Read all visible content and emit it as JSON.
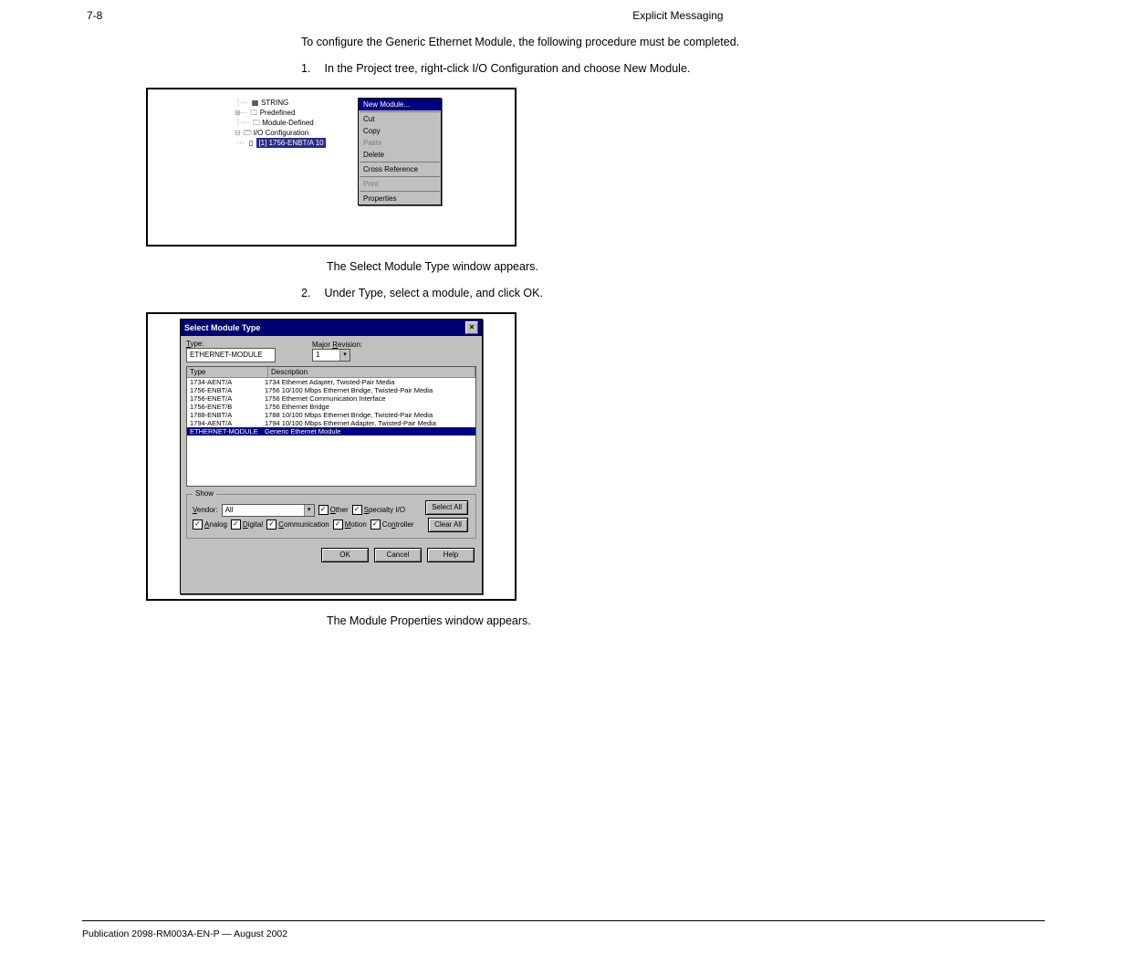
{
  "header": {
    "page_number": "7-8",
    "section": "Explicit Messaging"
  },
  "intro_text": "To configure the Generic Ethernet Module, the following procedure must be completed.",
  "step1": "In the Project tree, right-click I/O Configuration and choose New Module.",
  "tree": {
    "item_string": "STRING",
    "item_predefined": "Predefined",
    "item_module_defined": "Module-Defined",
    "item_io_config": "I/O Configuration",
    "selected_module": "[1] 1756-ENBT/A 10"
  },
  "context_menu": {
    "new_module": "New Module...",
    "cut": "Cut",
    "copy": "Copy",
    "paste": "Paste",
    "delete": "Delete",
    "cross_reference": "Cross Reference",
    "print": "Print",
    "properties": "Properties"
  },
  "step2": "The Select Module Type window appears.",
  "step3": "Under Type, select a module, and click OK.",
  "dialog": {
    "title": "Select Module Type",
    "type_label": "Type:",
    "type_value": "ETHERNET-MODULE",
    "major_rev_label": "Major Revision:",
    "major_rev_value": "1",
    "col_type": "Type",
    "col_desc": "Description",
    "rows": [
      {
        "type": "1734-AENT/A",
        "desc": "1734 Ethernet Adapter, Twisted-Pair Media"
      },
      {
        "type": "1756-ENBT/A",
        "desc": "1756 10/100 Mbps Ethernet Bridge, Twisted-Pair Media"
      },
      {
        "type": "1756-ENET/A",
        "desc": "1756 Ethernet Communication Interface"
      },
      {
        "type": "1756-ENET/B",
        "desc": "1756 Ethernet Bridge"
      },
      {
        "type": "1788-ENBT/A",
        "desc": "1788 10/100 Mbps Ethernet Bridge, Twisted-Pair Media"
      },
      {
        "type": "1794-AENT/A",
        "desc": "1794 10/100 Mbps Ethernet Adapter, Twisted-Pair Media"
      },
      {
        "type": "ETHERNET-MODULE",
        "desc": "Generic Ethernet Module"
      }
    ],
    "show_legend": "Show",
    "vendor_label": "Vendor:",
    "vendor_value": "All",
    "chk_other": "Other",
    "chk_specialty": "Specialty I/O",
    "btn_select_all": "Select All",
    "chk_analog": "Analog",
    "chk_digital": "Digital",
    "chk_comm": "Communication",
    "chk_motion": "Motion",
    "chk_controller": "Controller",
    "btn_clear_all": "Clear All",
    "btn_ok": "OK",
    "btn_cancel": "Cancel",
    "btn_help": "Help"
  },
  "step4": "The Module Properties window appears.",
  "footer": {
    "pub": "Publication 2098-RM003A-EN-P — August 2002",
    "right": ""
  }
}
